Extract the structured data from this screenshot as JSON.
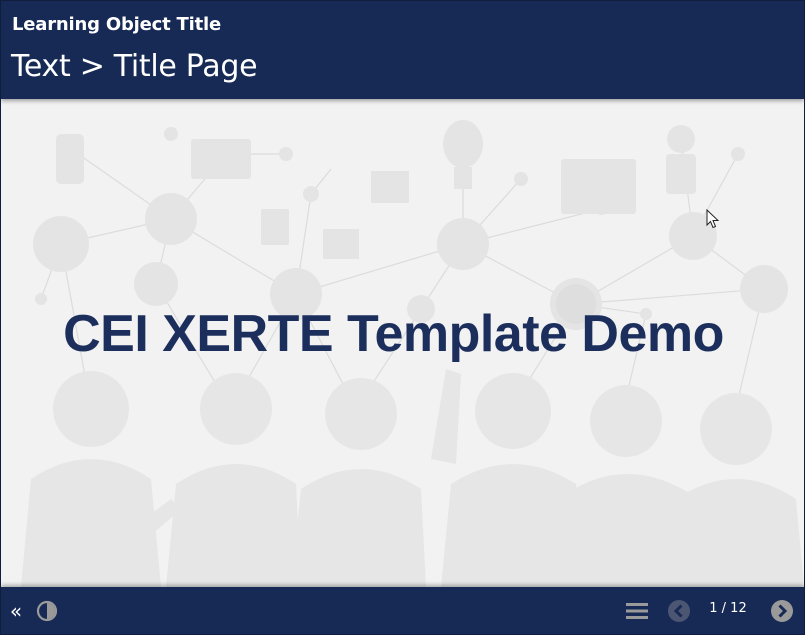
{
  "header": {
    "learning_object_title": "Learning Object Title",
    "page_title": "Text > Title Page"
  },
  "main": {
    "title": "CEI XERTE Template Demo",
    "background": "faint network of people silhouettes and icons"
  },
  "footer": {
    "collapse_label": "«",
    "contrast_icon": "contrast-icon",
    "toc_icon": "menu-icon",
    "prev_icon": "chevron-left-icon",
    "next_icon": "chevron-right-icon",
    "page_counter": "1 / 12"
  },
  "colors": {
    "bar": "#172a55",
    "title_text": "#1c2f5c",
    "stage_bg": "#f2f2f2",
    "icon_grey": "#9a9a9a",
    "icon_disabled": "#4c5672"
  }
}
